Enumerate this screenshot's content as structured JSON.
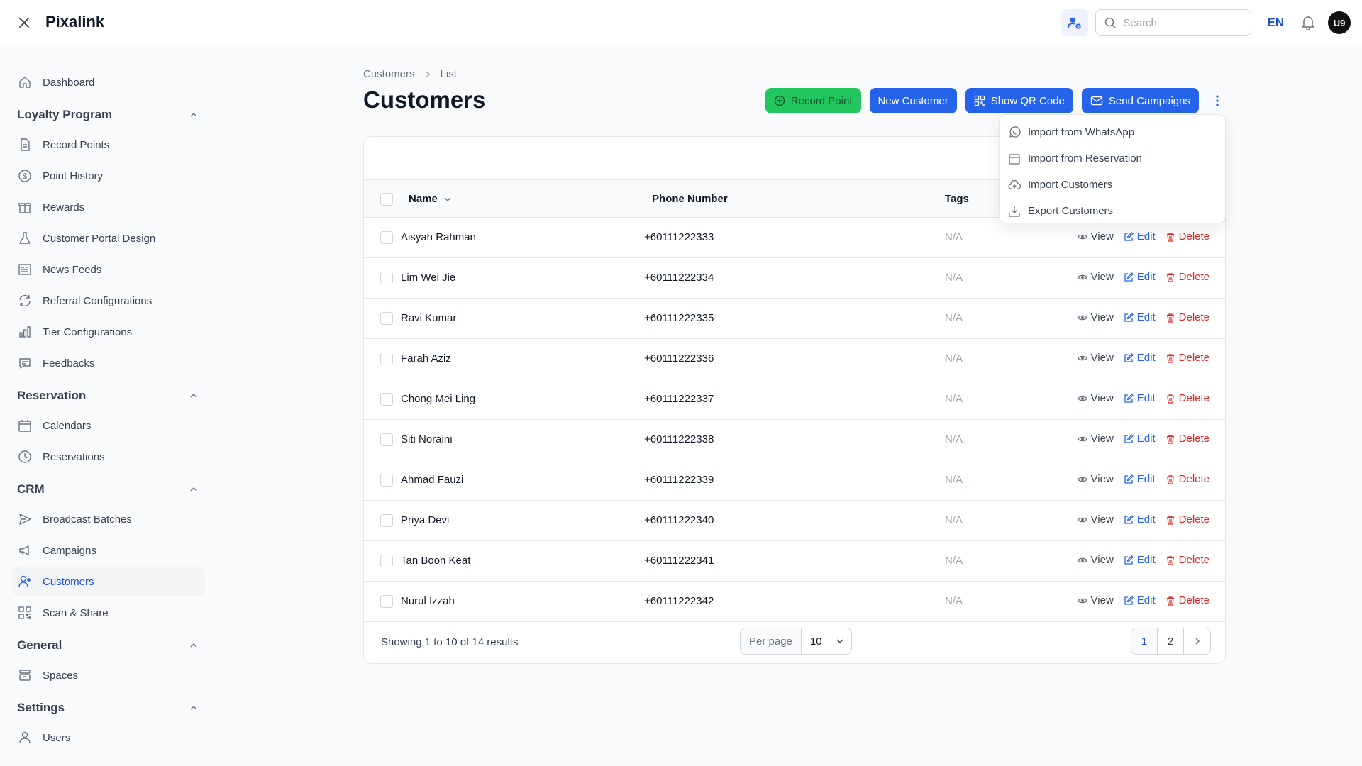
{
  "app": {
    "brand": "Pixalink"
  },
  "topbar": {
    "search_placeholder": "Search",
    "language": "EN",
    "avatar_initials": "U9"
  },
  "sidebar": {
    "dashboard": "Dashboard",
    "groups": {
      "loyalty": "Loyalty Program",
      "reservation": "Reservation",
      "crm": "CRM",
      "general": "General",
      "settings": "Settings"
    },
    "items": {
      "record_points": "Record Points",
      "point_history": "Point History",
      "rewards": "Rewards",
      "customer_portal_design": "Customer Portal Design",
      "news_feeds": "News Feeds",
      "referral_configurations": "Referral Configurations",
      "tier_configurations": "Tier Configurations",
      "feedbacks": "Feedbacks",
      "calendars": "Calendars",
      "reservations": "Reservations",
      "broadcast_batches": "Broadcast Batches",
      "campaigns": "Campaigns",
      "customers": "Customers",
      "scan_share": "Scan & Share",
      "spaces": "Spaces",
      "users": "Users"
    }
  },
  "breadcrumb": {
    "parent": "Customers",
    "current": "List"
  },
  "page": {
    "title": "Customers"
  },
  "actions": {
    "record_point": "Record Point",
    "new_customer": "New Customer",
    "show_qr": "Show QR Code",
    "send_campaigns": "Send Campaigns"
  },
  "dropdown": {
    "import_whatsapp": "Import from WhatsApp",
    "import_reservation": "Import from Reservation",
    "import_customers": "Import Customers",
    "export_customers": "Export Customers"
  },
  "table": {
    "columns": {
      "name": "Name",
      "phone": "Phone Number",
      "tags": "Tags"
    },
    "row_actions": {
      "view": "View",
      "edit": "Edit",
      "delete": "Delete"
    },
    "rows": [
      {
        "name": "Aisyah Rahman",
        "phone": "+60111222333",
        "tags": "N/A"
      },
      {
        "name": "Lim Wei Jie",
        "phone": "+60111222334",
        "tags": "N/A"
      },
      {
        "name": "Ravi Kumar",
        "phone": "+60111222335",
        "tags": "N/A"
      },
      {
        "name": "Farah Aziz",
        "phone": "+60111222336",
        "tags": "N/A"
      },
      {
        "name": "Chong Mei Ling",
        "phone": "+60111222337",
        "tags": "N/A"
      },
      {
        "name": "Siti Noraini",
        "phone": "+60111222338",
        "tags": "N/A"
      },
      {
        "name": "Ahmad Fauzi",
        "phone": "+60111222339",
        "tags": "N/A"
      },
      {
        "name": "Priya Devi",
        "phone": "+60111222340",
        "tags": "N/A"
      },
      {
        "name": "Tan Boon Keat",
        "phone": "+60111222341",
        "tags": "N/A"
      },
      {
        "name": "Nurul Izzah",
        "phone": "+60111222342",
        "tags": "N/A"
      }
    ]
  },
  "footer": {
    "showing": "Showing 1 to 10 of 14 results",
    "per_page_label": "Per page",
    "per_page_value": "10",
    "pages": [
      "1",
      "2"
    ]
  },
  "colors": {
    "primary": "#2563eb",
    "success": "#22c55e",
    "danger": "#dc2626"
  }
}
